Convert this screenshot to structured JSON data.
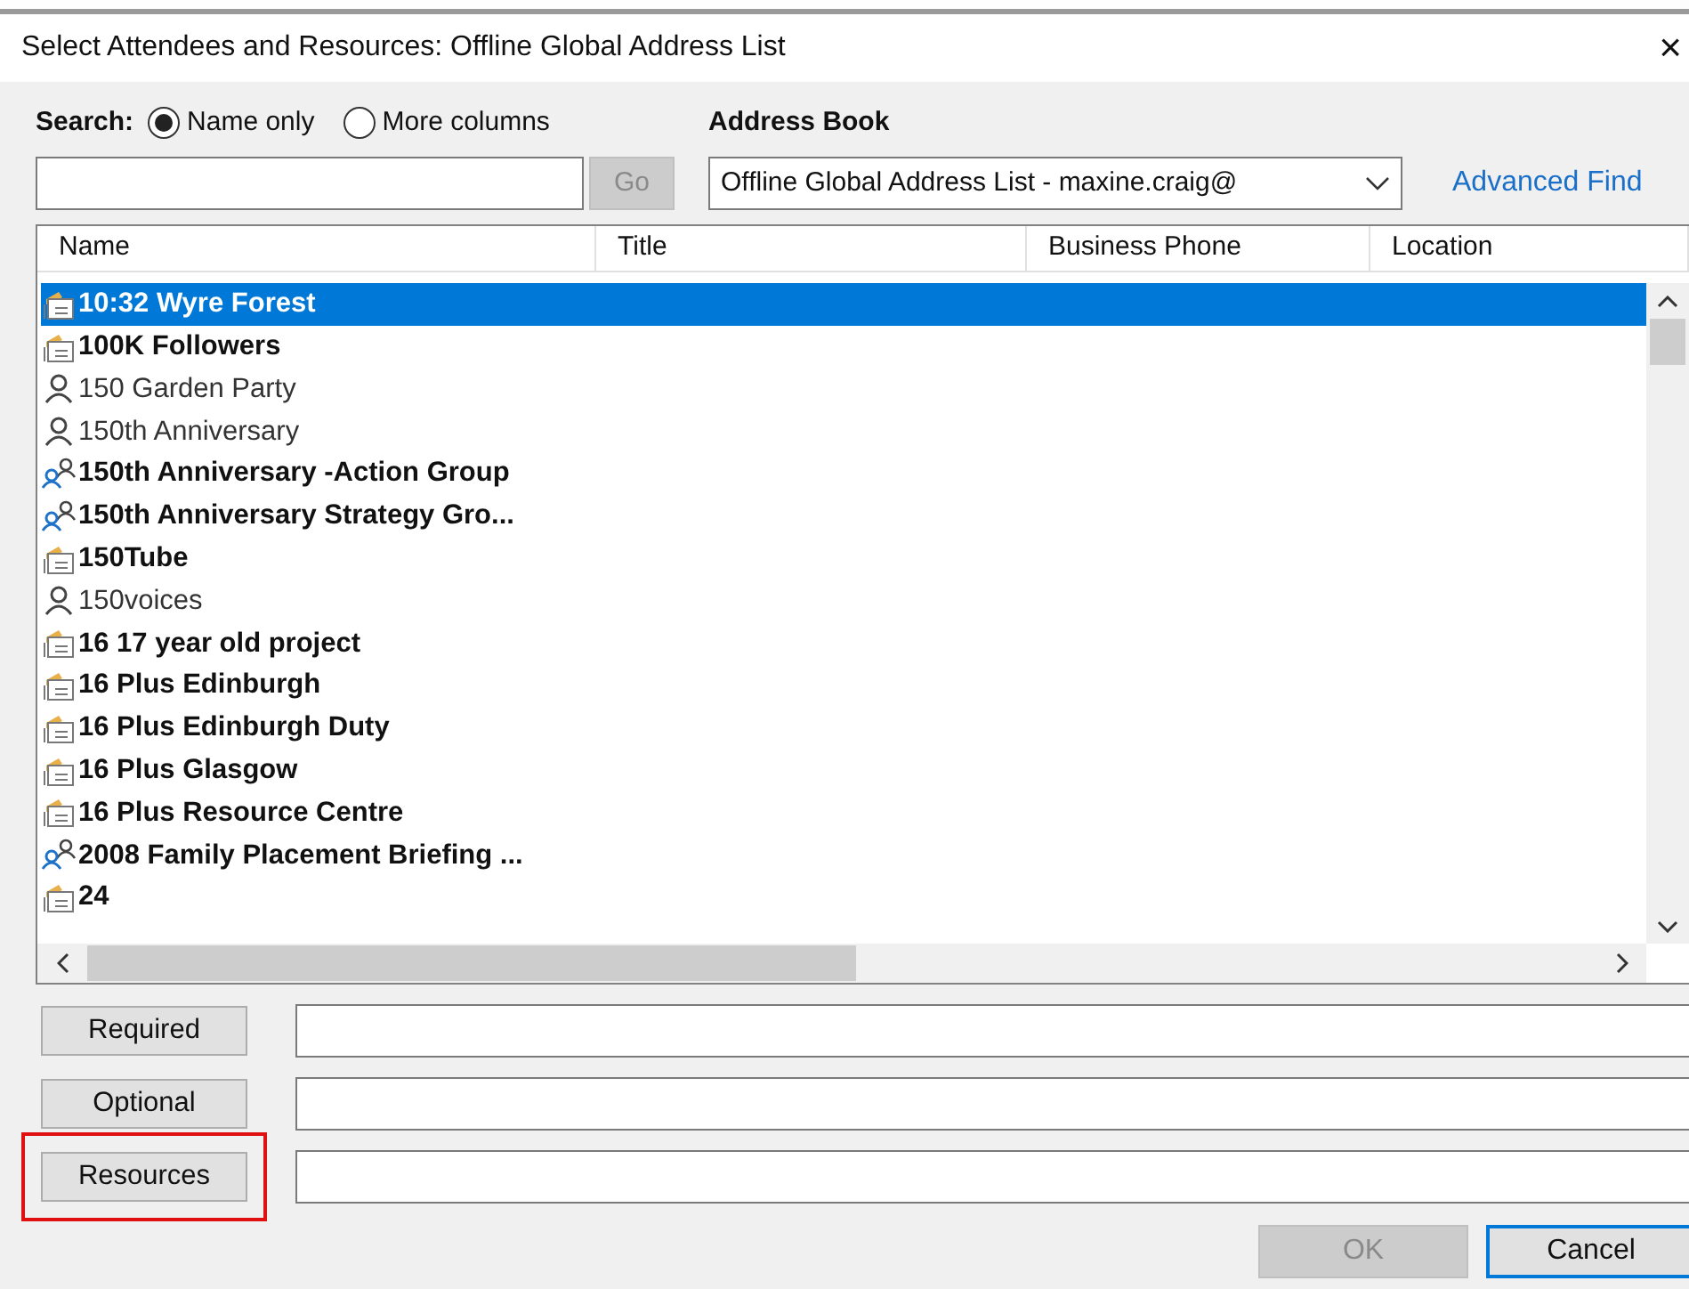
{
  "window": {
    "title": "Select Attendees and Resources: Offline Global Address List",
    "close": "×"
  },
  "search": {
    "label": "Search:",
    "options": [
      {
        "label": "Name only",
        "selected": true
      },
      {
        "label": "More columns",
        "selected": false
      }
    ],
    "go": "Go"
  },
  "address_book": {
    "label": "Address Book",
    "value": "Offline Global Address List - maxine.craig@",
    "advanced_find": "Advanced Find"
  },
  "table": {
    "columns": [
      "Name",
      "Title",
      "Business Phone",
      "Location"
    ],
    "rows": [
      {
        "name": "10:32 Wyre Forest",
        "kind": "room",
        "selected": true
      },
      {
        "name": "100K Followers",
        "kind": "room",
        "selected": false
      },
      {
        "name": "150 Garden Party",
        "kind": "user",
        "selected": false
      },
      {
        "name": "150th Anniversary",
        "kind": "user",
        "selected": false
      },
      {
        "name": "150th Anniversary -Action Group",
        "kind": "group",
        "selected": false
      },
      {
        "name": "150th Anniversary Strategy Gro...",
        "kind": "group",
        "selected": false
      },
      {
        "name": "150Tube",
        "kind": "room",
        "selected": false
      },
      {
        "name": "150voices",
        "kind": "user",
        "selected": false
      },
      {
        "name": "16 17 year old project",
        "kind": "room",
        "selected": false
      },
      {
        "name": "16 Plus Edinburgh",
        "kind": "room",
        "selected": false
      },
      {
        "name": "16 Plus Edinburgh Duty",
        "kind": "room",
        "selected": false
      },
      {
        "name": "16 Plus Glasgow",
        "kind": "room",
        "selected": false
      },
      {
        "name": "16 Plus Resource Centre",
        "kind": "room",
        "selected": false
      },
      {
        "name": "2008 Family Placement Briefing ...",
        "kind": "group",
        "selected": false
      },
      {
        "name": "24",
        "kind": "room",
        "selected": false
      }
    ]
  },
  "recipients": [
    {
      "label": "Required",
      "highlighted": false
    },
    {
      "label": "Optional",
      "highlighted": false
    },
    {
      "label": "Resources",
      "highlighted": true
    }
  ],
  "buttons": [
    {
      "label": "OK",
      "disabled": true,
      "default": false
    },
    {
      "label": "Cancel",
      "disabled": false,
      "default": true
    }
  ]
}
